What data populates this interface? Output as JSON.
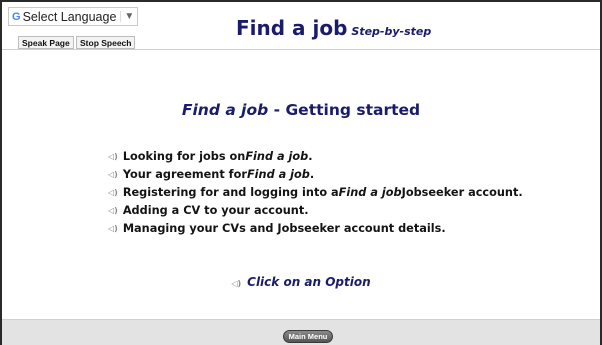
{
  "header": {
    "language_selector": "Select Language",
    "language_icon": "G",
    "language_arrow": "▼",
    "speak_page": "Speak Page",
    "stop_speech": "Stop Speech",
    "title": "Find a job",
    "title_sub": "Step-by-step"
  },
  "main": {
    "heading_em": "Find a job",
    "heading_rest": " - Getting started",
    "items": [
      {
        "icon": "speaker-icon",
        "parts": [
          "Looking for jobs on ",
          "Find a job",
          "."
        ]
      },
      {
        "icon": "speaker-icon",
        "parts": [
          "Your agreement for ",
          "Find a job",
          "."
        ]
      },
      {
        "icon": "speaker-icon",
        "parts": [
          "Registering for and logging into a ",
          "Find a job",
          " Jobseeker account."
        ]
      },
      {
        "icon": "speaker-icon",
        "parts": [
          "Adding a CV to your account.",
          "",
          ""
        ]
      },
      {
        "icon": "speaker-icon",
        "parts": [
          "Managing your CVs and Jobseeker account details.",
          "",
          ""
        ]
      }
    ],
    "option_label": "Click on an Option"
  },
  "footer": {
    "main_menu": "Main Menu"
  },
  "colors": {
    "title": "#1b1b6b",
    "footer_bg": "#e3e3e3",
    "button_bg": "#555555"
  }
}
